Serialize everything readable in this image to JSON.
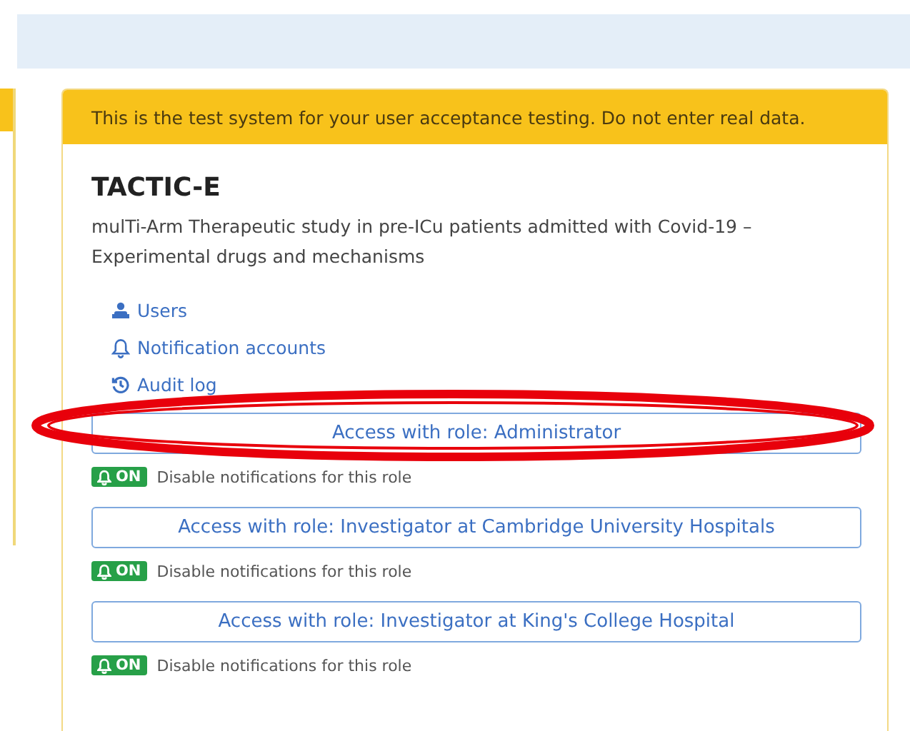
{
  "banner": "This is the test system for your user acceptance testing. Do not enter real data.",
  "trial": {
    "title": "TACTIC-E",
    "description": "mulTi-Arm Therapeutic study in pre-ICu patients admitted with Covid-19 – Experimental drugs and mechanisms"
  },
  "links": [
    {
      "kind": "users",
      "label": "Users"
    },
    {
      "kind": "notifications",
      "label": "Notification accounts"
    },
    {
      "kind": "audit",
      "label": "Audit log"
    }
  ],
  "roles": [
    {
      "button": "Access with role: Administrator",
      "badge": "ON",
      "on": true,
      "toggle": "Disable notifications for this role"
    },
    {
      "button": "Access with role: Investigator at Cambridge University Hospitals",
      "badge": "ON",
      "on": true,
      "toggle": "Disable notifications for this role"
    },
    {
      "button": "Access with role: Investigator at King's College Hospital",
      "badge": "ON",
      "on": true,
      "toggle": "Disable notifications for this role"
    }
  ],
  "annotation": {
    "kind": "ellipse"
  }
}
